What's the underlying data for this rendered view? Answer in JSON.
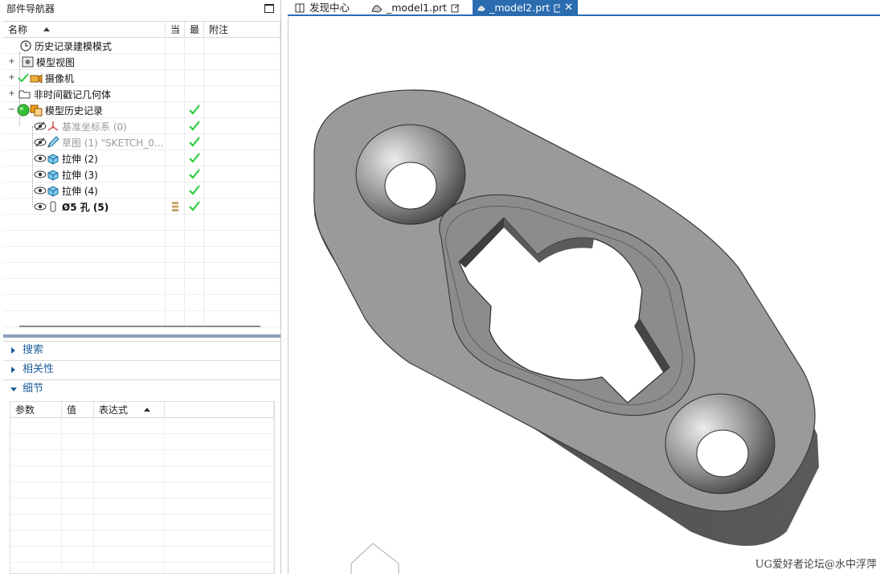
{
  "navigator": {
    "title": "部件导航器",
    "columns": {
      "name": "名称",
      "current": "当",
      "latest": "最",
      "notes": "附注"
    },
    "rows": [
      {
        "label": "历史记录建模模式",
        "icon": "history-clock-icon"
      },
      {
        "label": "模型视图",
        "icon": "model-view-icon"
      },
      {
        "label": "摄像机",
        "icon": "camera-icon"
      },
      {
        "label": "非时间戳记几何体",
        "icon": "folder-icon"
      },
      {
        "label": "模型历史记录",
        "icon": "model-history-icon"
      },
      {
        "label": "基准坐标系 (0)",
        "icon": "datum-csys-icon"
      },
      {
        "label": "草图 (1) \"SKETCH_0...",
        "icon": "sketch-icon"
      },
      {
        "label": "拉伸 (2)",
        "icon": "extrude-icon"
      },
      {
        "label": "拉伸 (3)",
        "icon": "extrude-icon"
      },
      {
        "label": "拉伸 (4)",
        "icon": "extrude-icon"
      },
      {
        "label": "Ø5 孔 (5)",
        "icon": "hole-icon"
      }
    ]
  },
  "panels": {
    "search": "搜索",
    "dependencies": "相关性",
    "details": "细节"
  },
  "details": {
    "columns": {
      "param": "参数",
      "value": "值",
      "expression": "表达式"
    }
  },
  "tabs": [
    {
      "label": "发现中心",
      "icon": "book-icon"
    },
    {
      "label": "_model1.prt",
      "icon": "part-icon"
    },
    {
      "label": "_model2.prt",
      "icon": "part-icon",
      "active": true
    }
  ],
  "watermark": "UG爱好者论坛@水中浮萍",
  "colors": {
    "accent": "#2b6cb0",
    "check": "#2ecc40"
  }
}
